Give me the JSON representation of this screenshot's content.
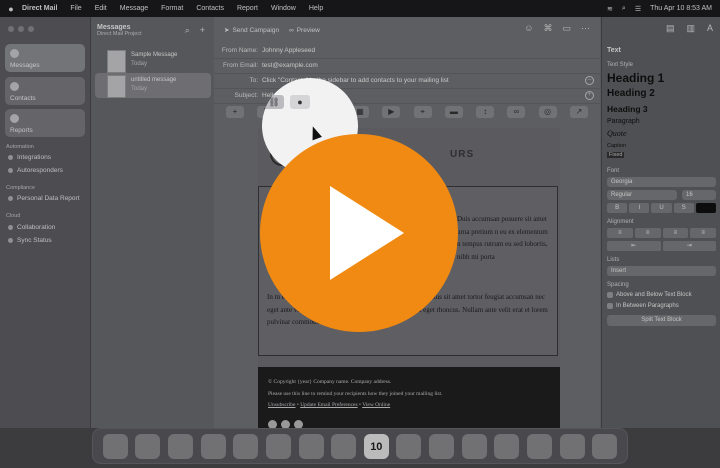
{
  "menubar": {
    "app": "Direct Mail",
    "items": [
      "File",
      "Edit",
      "Message",
      "Format",
      "Contacts",
      "Report",
      "Window",
      "Help"
    ],
    "datetime": "Thu Apr 10 8:53 AM"
  },
  "sidebar": {
    "cards": [
      {
        "label": "Messages",
        "icon": "paper-plane-icon"
      },
      {
        "label": "Contacts",
        "icon": "person-icon"
      },
      {
        "label": "Reports",
        "icon": "chart-icon"
      }
    ],
    "automation_header": "Automation",
    "automation_items": [
      "Integrations",
      "Autoresponders"
    ],
    "compliance_header": "Compliance",
    "compliance_items": [
      "Personal Data Report"
    ],
    "cloud_header": "Cloud",
    "cloud_items": [
      "Collaboration",
      "Sync Status"
    ]
  },
  "list": {
    "title": "Messages",
    "subtitle": "Direct Mail Project",
    "messages": [
      {
        "title": "Sample Message",
        "date": "Today"
      },
      {
        "title": "untitled message",
        "date": "Today"
      }
    ]
  },
  "toolbar": {
    "send": "Send Campaign",
    "preview": "Preview"
  },
  "headers": {
    "from_name_label": "From Name:",
    "from_name": "Johnny Appleseed",
    "from_email_label": "From Email:",
    "from_email": "test@example.com",
    "to_label": "To:",
    "to": "Click \"Contacts\" in the sidebar to add contacts to your mailing list",
    "subject_label": "Subject:",
    "subject": "Hello World!"
  },
  "canvas": {
    "logo_text": "URS",
    "para1": "Duis accumsan posuere sit amet urna pretium n eu ex elementum n tempus rutrum eu sed lobortis, nibh mi porta",
    "para2": "In m              e ligula. Praesent nec tortor vel metus              Phasellus eu lectus sit amet tortor feugiat accumsan nec eget ante vel dapibus. Praesent cursus venenatis magna eget rhoncus. Nullam ante velit erat et lorem pulvinar commodo vitae nec elit.",
    "footer_copy": "© Copyright {year} Company name. Company address.",
    "footer_remind": "Please use this line to remind your recipients how they joined your mailing list.",
    "footer_unsub": "Unsubscribe",
    "footer_update": "Update Email Preferences",
    "footer_view": "View Online",
    "footer_sep": "•"
  },
  "inspector": {
    "title": "Text",
    "text_style": "Text Style",
    "styles": [
      "Heading 1",
      "Heading 2",
      "Heading 3",
      "Paragraph",
      "Quote",
      "Caption",
      "Fixed"
    ],
    "font_label": "Font",
    "font_family": "Georgia",
    "font_weight": "Regular",
    "font_size": "16",
    "format_buttons": [
      "B",
      "I",
      "U",
      "S"
    ],
    "alignment_label": "Alignment",
    "lists_label": "Lists",
    "lists_value": "Insert",
    "spacing_label": "Spacing",
    "spacing_above": "Above and Below Text Block",
    "spacing_between": "In Between Paragraphs",
    "split_button": "Split Text Block"
  },
  "dock": {
    "calendar_day": "10"
  },
  "colors": {
    "play": "#f08a13",
    "highlight": "#f2f2f2"
  }
}
